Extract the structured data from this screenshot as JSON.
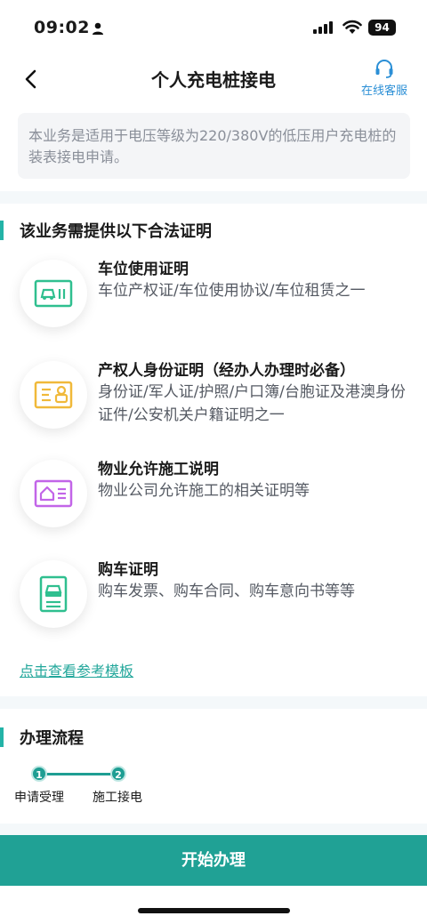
{
  "status_bar": {
    "time": "09:02",
    "battery": "94"
  },
  "nav": {
    "title": "个人充电桩接电",
    "service_label": "在线客服"
  },
  "notice": "本业务是适用于电压等级为220/380V的低压用户充电桩的装表接电申请。",
  "certificates_section": {
    "title": "该业务需提供以下合法证明",
    "items": [
      {
        "title": "车位使用证明",
        "desc": "车位产权证/车位使用协议/车位租赁之一",
        "icon": "parking-card-icon",
        "color": "#2fbf8f"
      },
      {
        "title": "产权人身份证明（经办人办理时必备）",
        "desc": "身份证/军人证/护照/户口簿/台胞证及港澳身份证件/公安机关户籍证明之一",
        "icon": "id-card-icon",
        "color": "#f0b93a"
      },
      {
        "title": "物业允许施工说明",
        "desc": "物业公司允许施工的相关证明等",
        "icon": "property-house-icon",
        "color": "#c265e8"
      },
      {
        "title": "购车证明",
        "desc": "购车发票、购车合同、购车意向书等等",
        "icon": "car-document-icon",
        "color": "#2fbf8f"
      }
    ],
    "template_link": "点击查看参考模板"
  },
  "process_section": {
    "title": "办理流程",
    "steps": [
      {
        "number": "1",
        "label": "申请受理"
      },
      {
        "number": "2",
        "label": "施工接电"
      }
    ]
  },
  "start_button": "开始办理",
  "colors": {
    "accent": "#20a195",
    "link": "#23a79b",
    "service": "#2b8fd6"
  }
}
